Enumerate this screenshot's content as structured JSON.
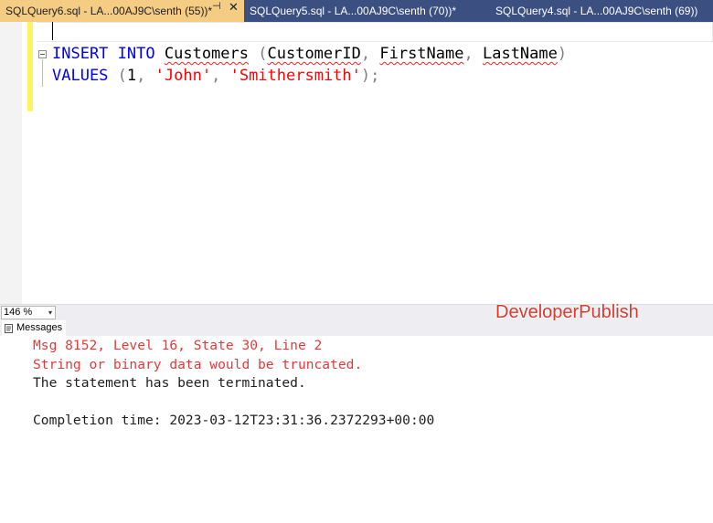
{
  "tabs": [
    {
      "label": "SQLQuery6.sql - LA...00AJ9C\\senth (55))*",
      "active": true
    },
    {
      "label": "SQLQuery5.sql - LA...00AJ9C\\senth (70))*",
      "active": false
    },
    {
      "label": "SQLQuery4.sql - LA...00AJ9C\\senth (69))",
      "active": false
    }
  ],
  "tab_pin_glyph": "⊣",
  "tab_close_glyph": "✕",
  "editor": {
    "line1": {
      "insert": "INSERT",
      "into": "INTO",
      "table": "Customers",
      "open_paren": "(",
      "col1": "CustomerID",
      "comma1": ",",
      "col2": "FirstName",
      "comma2": ",",
      "col3": "LastName",
      "close_paren": ")"
    },
    "line2": {
      "values": "VALUES",
      "open_paren": "(",
      "num": "1",
      "comma1": ",",
      "str1": "'John'",
      "comma2": ",",
      "str2": "'Smithersmith'",
      "close": ");"
    }
  },
  "zoom": {
    "value": "146 %",
    "arrow": "▾"
  },
  "watermark": "DeveloperPublish",
  "messages_tab": {
    "label": "Messages",
    "icon": "messages-icon"
  },
  "messages": [
    {
      "text": "Msg 8152, Level 16, State 30, Line 2",
      "type": "error"
    },
    {
      "text": "String or binary data would be truncated.",
      "type": "error"
    },
    {
      "text": "The statement has been terminated.",
      "type": "normal"
    },
    {
      "text": "",
      "type": "blank"
    },
    {
      "text": "Completion time: 2023-03-12T23:31:36.2372293+00:00",
      "type": "normal"
    }
  ],
  "colors": {
    "tab_strip": "#3b4f81",
    "active_tab": "#f5cc84",
    "keyword": "#0000ff",
    "string": "#ff0000",
    "error": "#e23a3a",
    "watermark": "#d83a2b"
  }
}
